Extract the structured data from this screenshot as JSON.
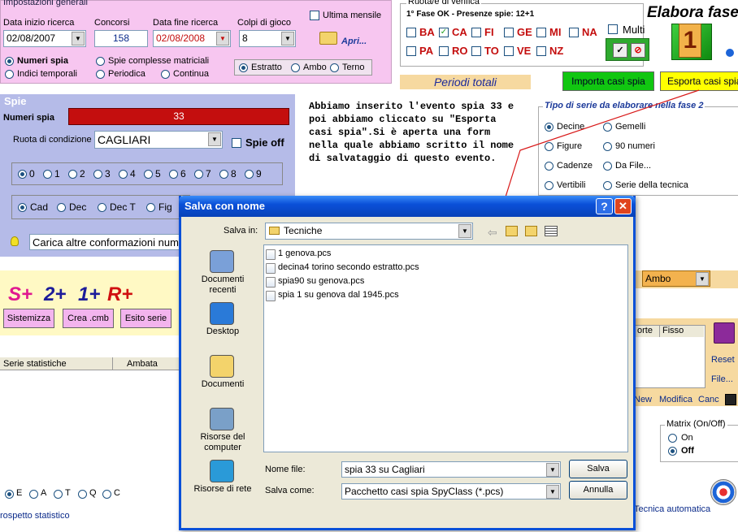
{
  "impostazioni": {
    "title": "Impostazioni generali",
    "data_inizio_label": "Data inizio ricerca",
    "data_inizio": "02/08/2007",
    "concorsi_label": "Concorsi",
    "concorsi": "158",
    "data_fine_label": "Data fine ricerca",
    "data_fine": "02/08/2008",
    "colpi_label": "Colpi di gioco",
    "colpi": "8",
    "ultima_mensile": "Ultima mensile",
    "apri": "Apri...",
    "numeri_spia": "Numeri spia",
    "spie_complesse": "Spie complesse matriciali",
    "indici_temporali": "Indici temporali",
    "periodica": "Periodica",
    "continua": "Continua",
    "estratto": "Estratto",
    "ambo": "Ambo",
    "terno": "Terno"
  },
  "ruota": {
    "title": "Ruota/e di verifica",
    "fase_info": "1° Fase OK - Presenze spie: 12+1",
    "wheels_row1": [
      "BA",
      "CA",
      "FI",
      "GE",
      "MI",
      "NA"
    ],
    "wheels_row2": [
      "PA",
      "RO",
      "TO",
      "VE",
      "NZ"
    ],
    "multi": "Multi",
    "ok_glyph": "✓",
    "no_glyph": "⊘"
  },
  "elabora": {
    "title": "Elabora fase",
    "number": "1"
  },
  "periodi": {
    "label": "Periodi totali"
  },
  "buttons": {
    "importa": "Importa casi spia",
    "esporta": "Esporta casi spia"
  },
  "spie": {
    "title": "Spie",
    "numeri_label": "Numeri spia",
    "numeri_value": "33",
    "ruota_label": "Ruota di condizione",
    "ruota_value": "CAGLIARI",
    "spie_off": "Spie off",
    "digits": [
      "0",
      "1",
      "2",
      "3",
      "4",
      "5",
      "6",
      "7",
      "8",
      "9"
    ],
    "types": [
      "Cad",
      "Dec",
      "Dec T",
      "Fig"
    ],
    "carica": "Carica altre conformazioni num"
  },
  "note": {
    "text": "Abbiamo inserito l'evento spia 33 e poi abbiamo cliccato su \"Esporta casi spia\".Si è aperta una form nella quale abbiamo scritto il nome di salvataggio di questo evento."
  },
  "tipo_serie": {
    "title": "Tipo di serie da elaborare nella fase 2",
    "options": [
      "Decine",
      "Gemelli",
      "Figure",
      "90 numeri",
      "Cadenze",
      "Da File...",
      "Vertibili",
      "Serie della tecnica"
    ]
  },
  "ambo_select": {
    "value": "Ambo"
  },
  "lower_left": {
    "s": "S+",
    "n2": "2+",
    "n1": "1+",
    "r": "R+",
    "sistemizza": "Sistemizza",
    "crea_cmb": "Crea .cmb",
    "esito_serie": "Esito serie",
    "col_serie": "Serie statistiche",
    "col_ambata": "Ambata",
    "prospetto": "rospetto statistico",
    "eat": [
      "E",
      "A",
      "T",
      "Q",
      "C"
    ]
  },
  "right_panel": {
    "col_sorte": "orte",
    "col_fisso": "Fisso",
    "reset": "Reset",
    "file": "File...",
    "new": "New",
    "modifica": "Modifica",
    "canc": "Canc",
    "matrix_title": "Matrix (On/Off)",
    "on": "On",
    "off": "Off",
    "tecnica": "Tecnica automatica"
  },
  "dialog": {
    "title": "Salva con nome",
    "help": "?",
    "close": "✕",
    "salva_in_label": "Salva in:",
    "salva_in_value": "Tecniche",
    "places": [
      "Documenti recenti",
      "Desktop",
      "Documenti",
      "Risorse del computer",
      "Risorse di rete"
    ],
    "files": [
      "1 genova.pcs",
      "decina4 torino secondo estratto.pcs",
      "spia90 su genova.pcs",
      "spia 1 su genova dal 1945.pcs"
    ],
    "nome_file_label": "Nome file:",
    "nome_file_value": "spia 33 su Cagliari",
    "salva_come_label": "Salva come:",
    "salva_come_value": "Pacchetto casi spia SpyClass (*.pcs)",
    "salva_button": "Salva",
    "annulla_button": "Annulla"
  },
  "colors": {
    "pink_panel": "#f7c6f0",
    "blue_panel": "#b5bbe8",
    "xp_blue": "#0a50d8",
    "red_field": "#c40e0e"
  }
}
